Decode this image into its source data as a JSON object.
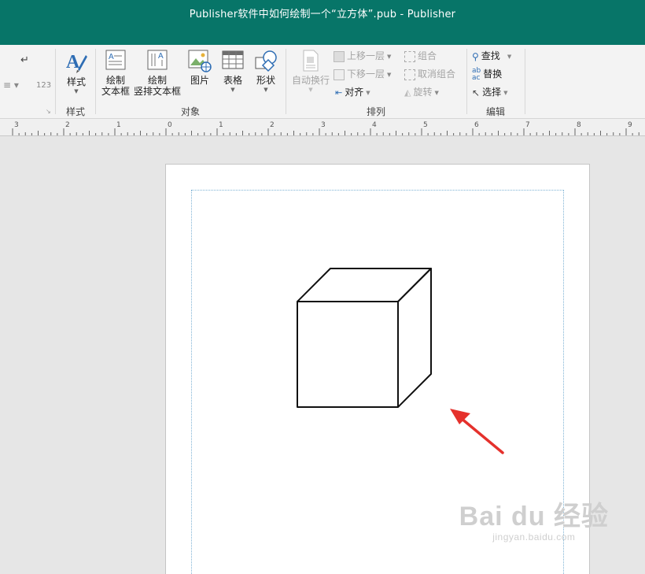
{
  "window": {
    "title": "Publisher软件中如何绘制一个“立方体”.pub - Publisher"
  },
  "ribbon": {
    "left_partial": {
      "label_123": "123"
    },
    "style_group": {
      "button": "样式",
      "label": "样式"
    },
    "object_group": {
      "draw_textbox": [
        "绘制",
        "文本框"
      ],
      "draw_vertical_textbox": [
        "绘制",
        "竖排文本框"
      ],
      "picture": "图片",
      "table": "表格",
      "shape": "形状",
      "label": "对象"
    },
    "arrange_group": {
      "wrap_text": "自动换行",
      "bring_forward": "上移一层",
      "send_backward": "下移一层",
      "align": "对齐",
      "group": "组合",
      "ungroup": "取消组合",
      "rotate": "旋转",
      "label": "排列"
    },
    "edit_group": {
      "find": "查找",
      "replace": "替换",
      "select": "选择",
      "label": "编辑"
    }
  },
  "ruler": {
    "numbers": [
      "3",
      "2",
      "1",
      "0",
      "1",
      "2",
      "3",
      "4",
      "5",
      "6",
      "7",
      "8",
      "9"
    ]
  },
  "watermark": {
    "main": "Bai du 经验",
    "sub": "jingyan.baidu.com"
  },
  "colors": {
    "titlebar": "#077568",
    "arrow": "#e5312c",
    "accent_icon": "#2e6db4"
  }
}
